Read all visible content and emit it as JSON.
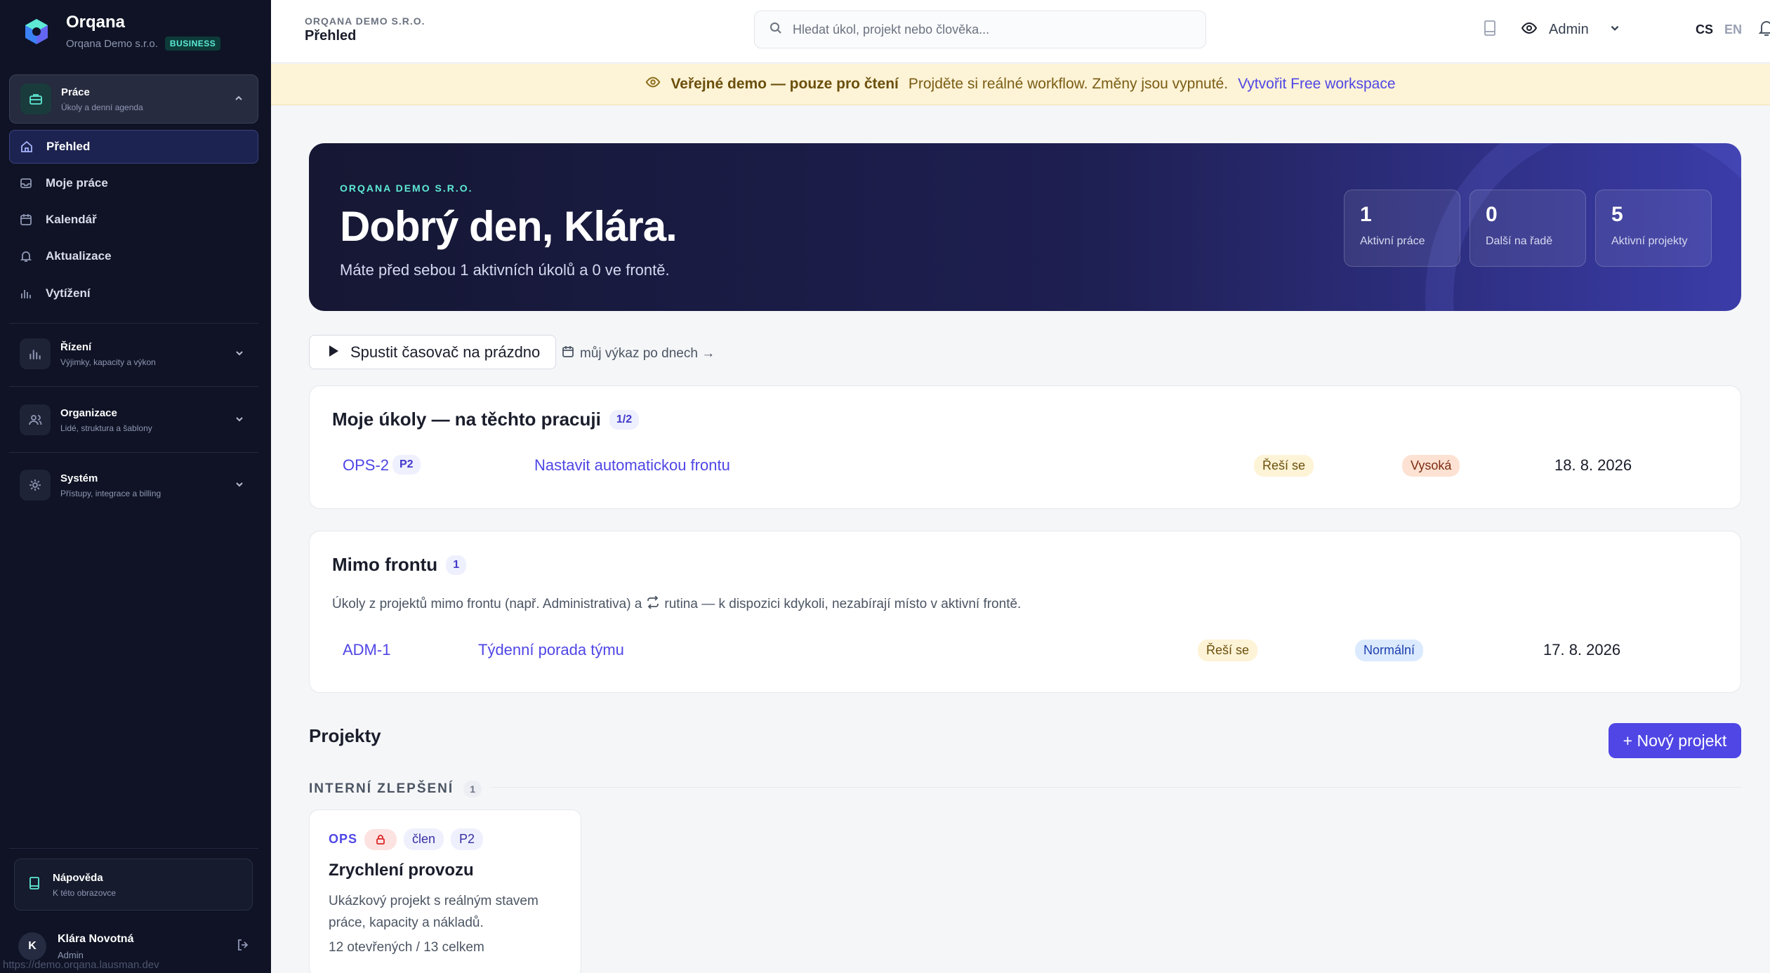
{
  "sidebar": {
    "brand_name": "Orqana",
    "org_name": "Orqana Demo s.r.o.",
    "plan_badge": "BUSINESS",
    "sections": [
      {
        "title": "Práce",
        "subtitle": "Úkoly a denní agenda"
      },
      {
        "title": "Řízení",
        "subtitle": "Výjimky, kapacity a výkon"
      },
      {
        "title": "Organizace",
        "subtitle": "Lidé, struktura a šablony"
      },
      {
        "title": "Systém",
        "subtitle": "Přístupy, integrace a billing"
      }
    ],
    "nav": [
      {
        "label": "Přehled"
      },
      {
        "label": "Moje práce"
      },
      {
        "label": "Kalendář"
      },
      {
        "label": "Aktualizace"
      },
      {
        "label": "Vytížení"
      }
    ],
    "help": {
      "title": "Nápověda",
      "subtitle": "K této obrazovce"
    },
    "user": {
      "initial": "K",
      "name": "Klára Novotná",
      "role": "Admin"
    },
    "status_url": "https://demo.orqana.lausman.dev"
  },
  "topbar": {
    "org": "ORQANA DEMO S.R.O.",
    "page": "Přehled",
    "search_placeholder": "Hledat úkol, projekt nebo člověka...",
    "role": "Admin",
    "lang_cs": "CS",
    "lang_en": "EN"
  },
  "banner": {
    "strong": "Veřejné demo — pouze pro čtení",
    "text": "Projděte si reálné workflow. Změny jsou vypnuté.",
    "link": "Vytvořit Free workspace"
  },
  "hero": {
    "org": "ORQANA DEMO S.R.O.",
    "greeting": "Dobrý den, Klára.",
    "subtitle": "Máte před sebou 1 aktivních úkolů a 0 ve frontě.",
    "stats": [
      {
        "value": "1",
        "label": "Aktivní práce"
      },
      {
        "value": "0",
        "label": "Další na řadě"
      },
      {
        "value": "5",
        "label": "Aktivní projekty"
      }
    ]
  },
  "actions": {
    "timer_label": "Spustit časovač na prázdno",
    "report_link": "můj výkaz po dnech →"
  },
  "my_tasks": {
    "title": "Moje úkoly — na těchto pracuji",
    "count": "1/2",
    "rows": [
      {
        "key": "OPS-2",
        "priority_code": "P2",
        "name": "Nastavit automatickou frontu",
        "status": "Řeší se",
        "priority": "Vysoká",
        "date": "18. 8. 2026"
      }
    ]
  },
  "off_queue": {
    "title": "Mimo frontu",
    "count": "1",
    "note_before": "Úkoly z projektů mimo frontu (např. Administrativa) a",
    "note_after": "rutina — k dispozici kdykoli, nezabírají místo v aktivní frontě.",
    "rows": [
      {
        "key": "ADM-1",
        "name": "Týdenní porada týmu",
        "status": "Řeší se",
        "priority": "Normální",
        "date": "17. 8. 2026"
      }
    ]
  },
  "projects": {
    "title": "Projekty",
    "new_button": "+ Nový projekt",
    "group_label": "INTERNÍ ZLEPŠENÍ",
    "group_count": "1",
    "cards": [
      {
        "key": "OPS",
        "role": "člen",
        "priority": "P2",
        "name": "Zrychlení provozu",
        "description": "Ukázkový projekt s reálným stavem práce, kapacity a nákladů.",
        "stats": "12 otevřených / 13 celkem"
      }
    ]
  }
}
